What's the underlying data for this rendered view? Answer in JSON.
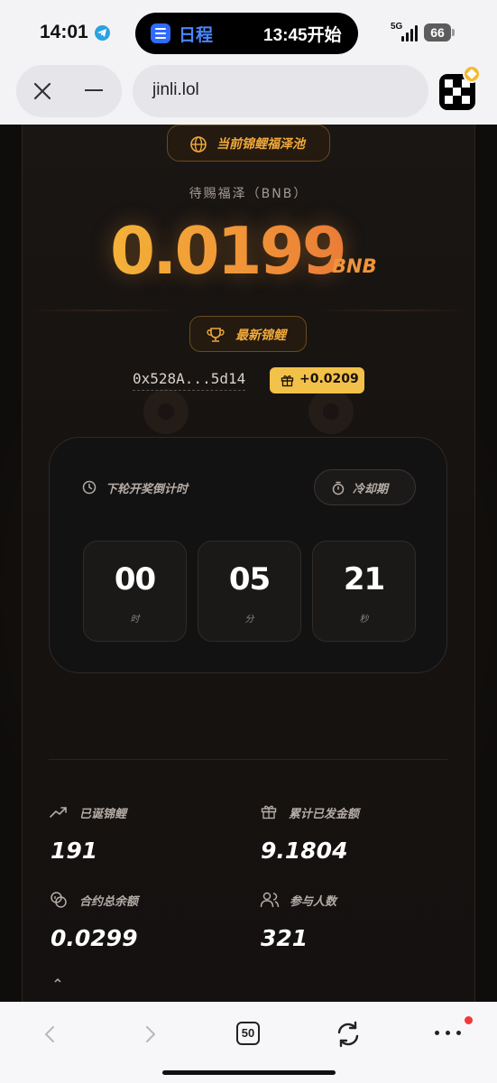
{
  "status_bar": {
    "time": "14:01",
    "island_app": "日程",
    "island_event": "13:45开始",
    "network": "5G",
    "battery": "66"
  },
  "browser": {
    "url": "jinli.lol"
  },
  "pool": {
    "badge_label": "当前锦鲤福泽池",
    "subtitle": "待赐福泽（BNB）",
    "amount": "0.0199",
    "unit": "BNB"
  },
  "winner": {
    "badge_label": "最新锦鲤",
    "address": "0x528A...5d14",
    "reward": "+0.0209"
  },
  "countdown": {
    "label": "下轮开奖倒计时",
    "state": "冷却期",
    "hours": "00",
    "hours_unit": "时",
    "minutes": "05",
    "minutes_unit": "分",
    "seconds": "21",
    "seconds_unit": "秒"
  },
  "stats": {
    "born": {
      "label": "已诞锦鲤",
      "value": "191"
    },
    "distributed": {
      "label": "累计已发金额",
      "value": "9.1804"
    },
    "balance": {
      "label": "合约总余额",
      "value": "0.0299"
    },
    "participants": {
      "label": "参与人数",
      "value": "321"
    }
  },
  "bottom_nav": {
    "tab_count": "50"
  },
  "colors": {
    "accent_orange": "#f0943a",
    "accent_gold": "#f2c14a",
    "background": "#0f0d0c"
  }
}
